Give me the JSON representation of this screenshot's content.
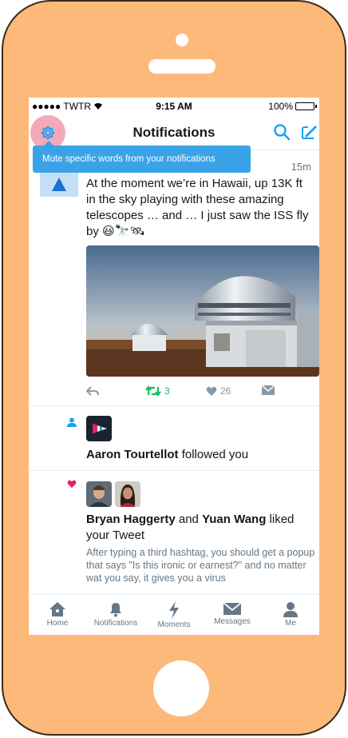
{
  "status_bar": {
    "carrier": "●●●●● TWTR",
    "time": "9:15 AM",
    "battery": "100%"
  },
  "header": {
    "title": "Notifications"
  },
  "tooltip": {
    "text": "Mute specific words from your notifications"
  },
  "tweet": {
    "time": "15m",
    "text": "At the moment we’re in Hawaii, up 13K ft in the sky playing with these amazing telescopes … and … I just saw the ISS fly by",
    "emoji": "😃🔭🛰",
    "retweets": "3",
    "likes": "26"
  },
  "follow": {
    "name": "Aaron Tourtellot",
    "action": " followed you"
  },
  "like": {
    "name1": "Bryan Haggerty",
    "joiner": " and ",
    "name2": "Yuan Wang",
    "action": " liked your Tweet",
    "quote": "After typing a third hashtag, you should get a popup that says \"Is this ironic or earnest?\" and no matter wat you say, it gives you a virus"
  },
  "tabs": [
    {
      "label": "Home",
      "icon": "home-icon"
    },
    {
      "label": "Notifications",
      "icon": "bell-icon"
    },
    {
      "label": "Moments",
      "icon": "lightning-icon"
    },
    {
      "label": "Messages",
      "icon": "envelope-icon"
    },
    {
      "label": "Me",
      "icon": "person-icon"
    }
  ],
  "colors": {
    "phone": "#fdb97a",
    "accent": "#1da1f2",
    "tooltip": "#3aa3e8",
    "retweet": "#17bf63",
    "like": "#e0245e"
  }
}
